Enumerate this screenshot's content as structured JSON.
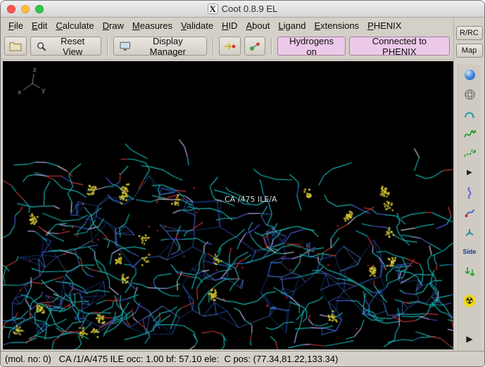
{
  "window": {
    "title": "Coot 0.8.9 EL",
    "icon_glyph": "X"
  },
  "menu_bar": {
    "items": [
      {
        "label": "File"
      },
      {
        "label": "Edit"
      },
      {
        "label": "Calculate"
      },
      {
        "label": "Draw"
      },
      {
        "label": "Measures"
      },
      {
        "label": "Validate"
      },
      {
        "label": "HID"
      },
      {
        "label": "About"
      },
      {
        "label": "Ligand"
      },
      {
        "label": "Extensions"
      },
      {
        "label": "PHENIX"
      }
    ]
  },
  "toolbar": {
    "reset_view_label": "Reset View",
    "display_manager_label": "Display Manager",
    "hydrogens_label": "Hydrogens on",
    "phenix_label": "Connected to PHENIX",
    "highlight_color": "#edc9e9"
  },
  "right_panel": {
    "rrc_label": "R/RC",
    "map_label": "Map",
    "side_label": "Side",
    "expand_glyph": "▶",
    "hazard_glyph": "☢",
    "icons": [
      "sphere-refine-icon",
      "globe-icon",
      "flip-peptide-icon",
      "real-space-refine-icon",
      "regularize-icon",
      "triangle-right-icon",
      "rot-trans-icon",
      "auto-fit-rotamer-icon",
      "rotamer-icon",
      "side-chain-icon",
      "jiggle-fit-icon",
      "radiation-icon",
      "more-triangle-icon"
    ]
  },
  "scene": {
    "atom_label": "CA /475 ILE/A",
    "axes_labels": [
      "x",
      "y",
      "z"
    ],
    "colors": {
      "background": "#000000",
      "mesh": "#2d5fd2",
      "mesh_bright": "#6ea0ff",
      "sticks": "#18b0ae",
      "oxygen": "#c23434",
      "nitrogen": "#4555cf",
      "dots": "#d3c62f",
      "red_dots": "#c02828"
    }
  },
  "status_bar": {
    "text": "(mol. no: 0)   CA /1/A/475 ILE occ: 1.00 bf: 57.10 ele:  C pos: (77.34,81.22,133.34)"
  }
}
